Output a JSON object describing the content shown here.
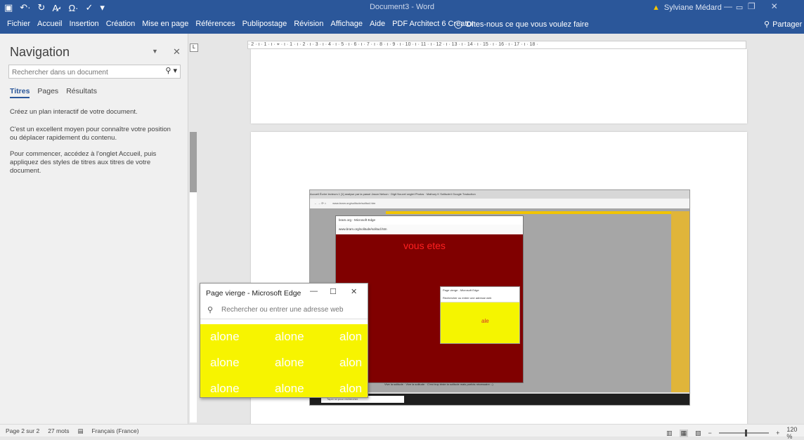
{
  "titlebar": {
    "doc_title": "Document3 - Word",
    "user": "Sylviane Médard"
  },
  "ribbon": {
    "tabs": [
      "Fichier",
      "Accueil",
      "Insertion",
      "Création",
      "Mise en page",
      "Références",
      "Publipostage",
      "Révision",
      "Affichage",
      "Aide",
      "PDF Architect 6 Creator"
    ],
    "tell_me": "Dites-nous ce que vous voulez faire",
    "share": "Partager"
  },
  "nav": {
    "title": "Navigation",
    "search_placeholder": "Rechercher dans un document",
    "tabs": [
      "Titres",
      "Pages",
      "Résultats"
    ],
    "p1": "Créez un plan interactif de votre document.",
    "p2": "C'est un excellent moyen pour connaître votre position ou déplacer rapidement du contenu.",
    "p3": "Pour commencer, accédez à l'onglet Accueil, puis appliquez des styles de titres aux titres de votre document."
  },
  "ruler": {
    "text": "· 2 · ı · 1 · ı · ⌖ · ı · 1 · ı · 2 · ı · 3 · ı · 4 · ı · 5 · ı · 6 · ı · 7 · ı · 8 · ı · 9 · ı · 10 · ı · 11 · ı · 12 · ı · 13 · ı · 14 · ı · 15 · ı · 16 · ı · 17 · ı · 18 ·"
  },
  "embedded": {
    "tabs_text": "Accueil   Écrire lecteurs 1 [1]   analyse par la passé   Jason Nelson · Digit   Nouvel onglet   Photos · Mathury K   Solitude4   Google Traduction",
    "url": "www.bram.org/solitude/solitud.htm",
    "w1_title": "bram.org - Microsoft Edge",
    "w1_url": "www.bram.org/solitude/solitud.htm",
    "w1_red": "vous etes",
    "w2_title": "Page vierge - Microsoft Edge",
    "w2_search": "Rechercher ou entrer une adresse web",
    "w2_text": "ale",
    "taskbar_search": "Taper ici pour rechercher",
    "bottom_text": "Vive la solitude · Vive la solitude · C'est trop triste la solitude mais parfois nécessaire :-)"
  },
  "edge": {
    "title": "Page vierge - Microsoft Edge",
    "address_placeholder": "Rechercher ou entrer une adresse web",
    "words": [
      "alone",
      "alone",
      "alon",
      "alone",
      "alone",
      "alon",
      "alone",
      "alone",
      "alon"
    ]
  },
  "status": {
    "page": "Page 2 sur 2",
    "words": "27 mots",
    "language": "Français (France)",
    "zoom": "120 %"
  },
  "colors": {
    "accent": "#2b579a",
    "yellow": "#f7f400",
    "darkred": "#800000",
    "red_text": "#ff2020"
  }
}
